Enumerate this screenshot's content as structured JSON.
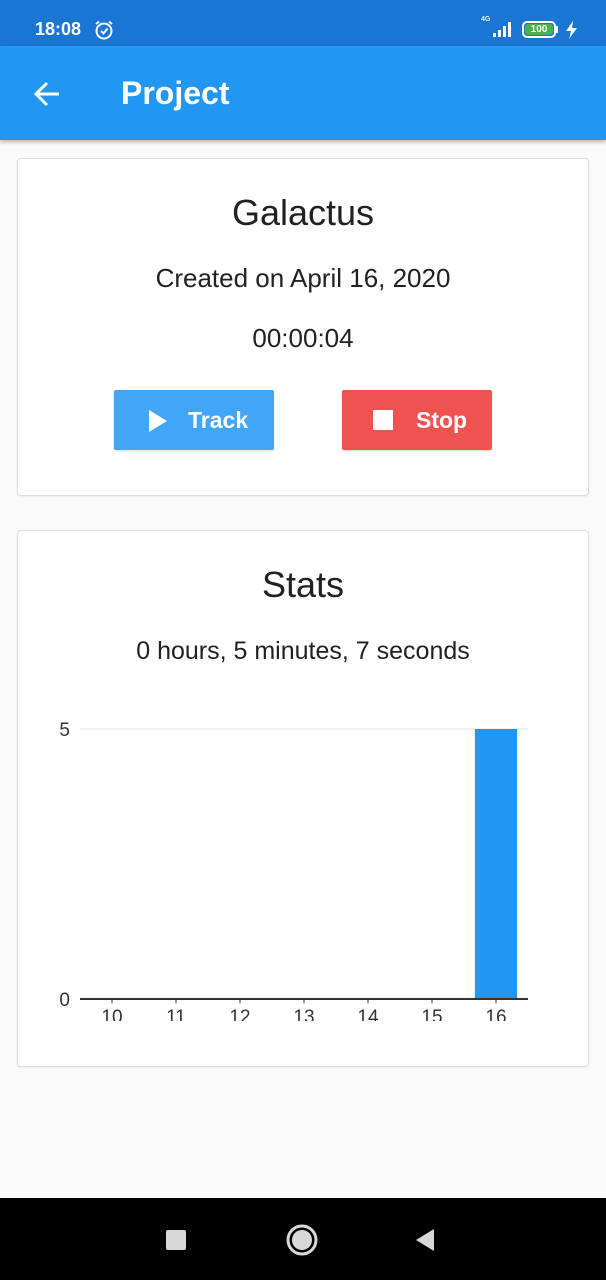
{
  "status_bar": {
    "time": "18:08",
    "network": "4G",
    "battery": "100",
    "icons": [
      "alarm-icon",
      "signal-icon",
      "battery-icon",
      "charging-bolt-icon"
    ]
  },
  "app_bar": {
    "title": "Project",
    "back_icon": "arrow-left-icon"
  },
  "project": {
    "name": "Galactus",
    "created": "Created on April 16, 2020",
    "timer": "00:00:04",
    "track_label": "Track",
    "track_icon": "play-icon",
    "stop_label": "Stop",
    "stop_icon": "stop-icon",
    "track_color": "#42a5f5",
    "stop_color": "#ef5350"
  },
  "stats": {
    "title": "Stats",
    "total": "0 hours, 5 minutes, 7 seconds"
  },
  "chart_data": {
    "type": "bar",
    "categories": [
      "10",
      "11",
      "12",
      "13",
      "14",
      "15",
      "16"
    ],
    "values": [
      0,
      0,
      0,
      0,
      0,
      0,
      5
    ],
    "ylim": [
      0,
      5
    ],
    "yticks": [
      "0",
      "5"
    ],
    "bar_color": "#2196f3",
    "grid": true
  },
  "nav_bar": {
    "icons": [
      "recents-square-icon",
      "home-circle-icon",
      "back-triangle-icon"
    ]
  },
  "theme": {
    "primary": "#2196f3",
    "primary_dark": "#1976d2"
  }
}
